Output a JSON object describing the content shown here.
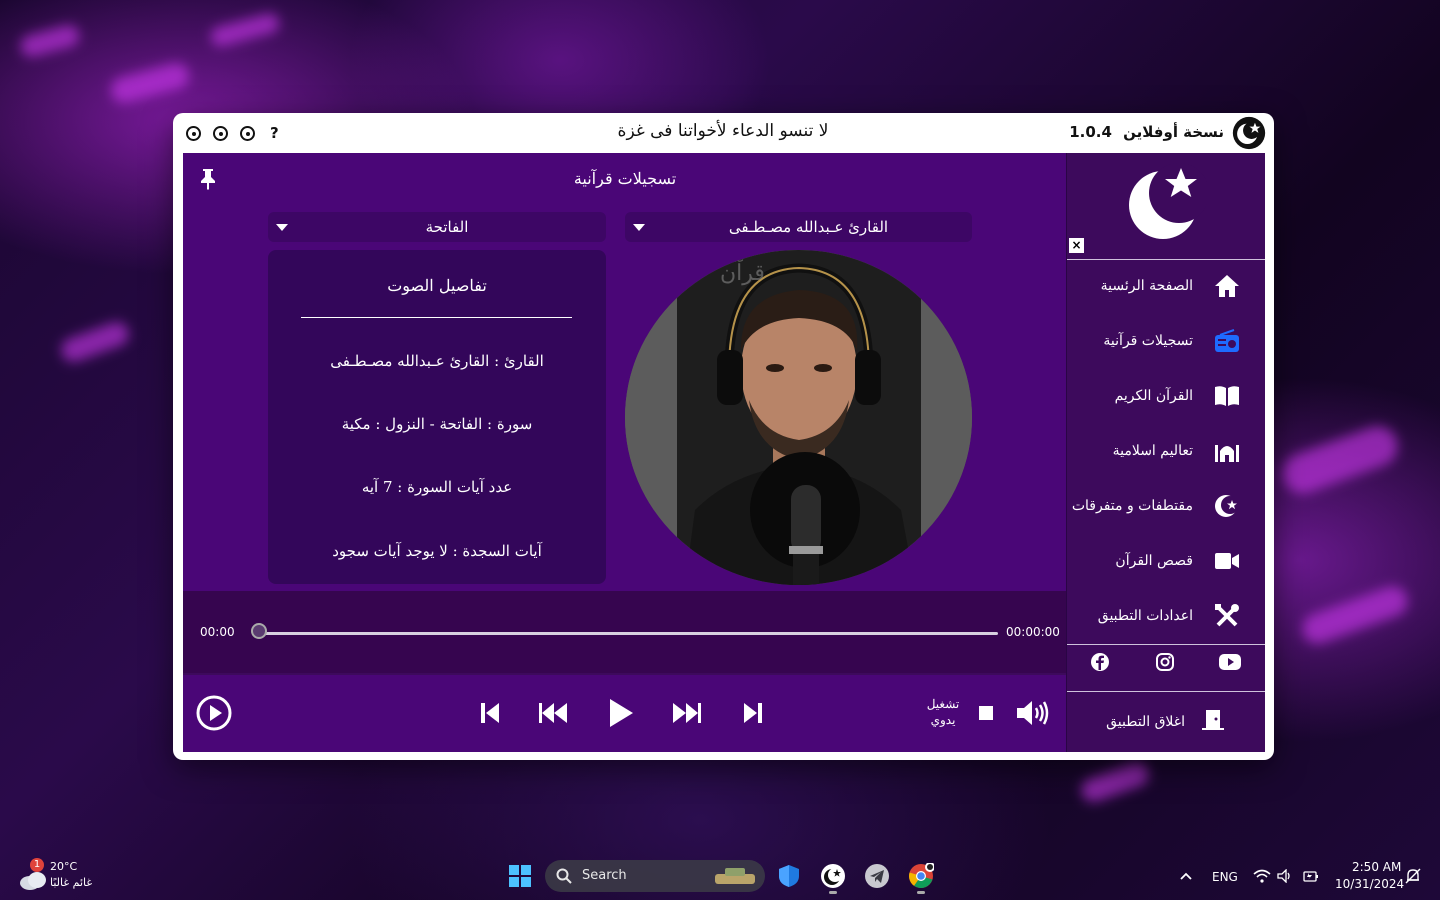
{
  "titlebar": {
    "edition": "نسخة أوفلاين",
    "version": "1.0.4",
    "center_message": "لا تنسو الدعاء لأخواتنا فى غزة",
    "help": "?"
  },
  "sidebar": {
    "close": "×",
    "items": [
      {
        "label": "الصفحة الرئسية",
        "icon": "home-icon"
      },
      {
        "label": "تسجيلات قرآنية",
        "icon": "radio-icon"
      },
      {
        "label": "القرآن الكريم",
        "icon": "book-icon"
      },
      {
        "label": "تعاليم اسلامية",
        "icon": "mosque-icon"
      },
      {
        "label": "مقتطفات و متفرقات",
        "icon": "crescent-star-icon"
      },
      {
        "label": "قصص القرآن",
        "icon": "video-camera-icon"
      },
      {
        "label": "اعدادات التطبيق",
        "icon": "tools-icon"
      }
    ],
    "exit_label": "اغلاق التطبيق"
  },
  "main": {
    "title": "تسجيلات قرآنية",
    "reciter_select": "القارئ عـبدالله مصـطـفى",
    "surah_select": "الفاتحة",
    "details": {
      "heading": "تفاصيل الصوت",
      "reciter": "القارئ : القارئ عـبدالله مصـطـفى",
      "surah": "سورة :  الفاتحة  -  النزول  :  مكية",
      "verses": "عدد آيات السورة :  7  آيه",
      "sajda": "آيات السجدة :  لا يوجد آيات سجود"
    }
  },
  "player": {
    "time_elapsed": "00:00",
    "time_total": "00:00:00",
    "progress": 0,
    "mode_line1": "تشغيل",
    "mode_line2": "يدوي"
  },
  "taskbar": {
    "temperature": "20°C",
    "weather": "غائم غالبًا",
    "weather_badge": "1",
    "search_placeholder": "Search",
    "language": "ENG",
    "time": "2:50 AM",
    "date": "10/31/2024"
  },
  "colors": {
    "panel": "#4a0677",
    "sidebar": "#3d0a5c",
    "accent_blue": "#1e6bff"
  }
}
